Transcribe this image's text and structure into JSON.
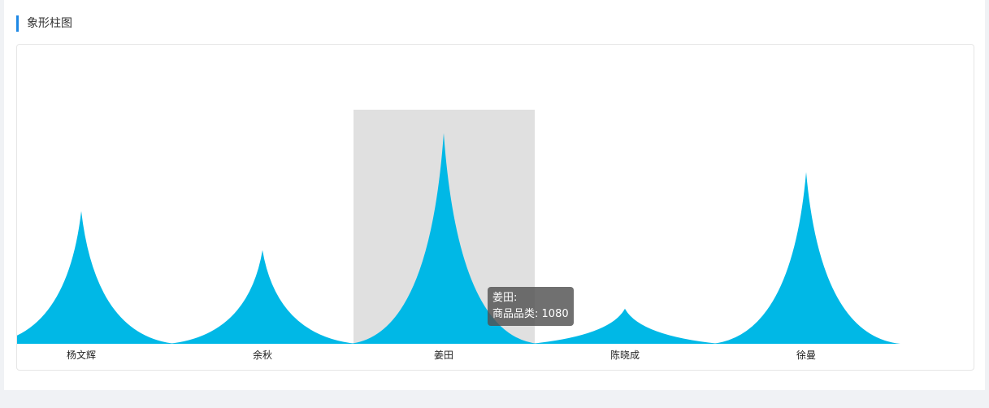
{
  "panel": {
    "title": "象形柱图"
  },
  "colors": {
    "accent": "#1e88e5",
    "bar": "#00b8e6",
    "highlight": "#e0e0e0"
  },
  "tooltip": {
    "name": "姜田:",
    "label": "商品品类:",
    "value": "1080"
  },
  "chart_data": {
    "type": "bar",
    "shape": "peak",
    "title": "",
    "categories": [
      "杨文辉",
      "余秋",
      "姜田",
      "陈晓成",
      "徐曼"
    ],
    "values": [
      680,
      480,
      1080,
      180,
      880
    ],
    "ylim": [
      0,
      1200
    ],
    "grid": false,
    "highlighted_index": 2
  }
}
